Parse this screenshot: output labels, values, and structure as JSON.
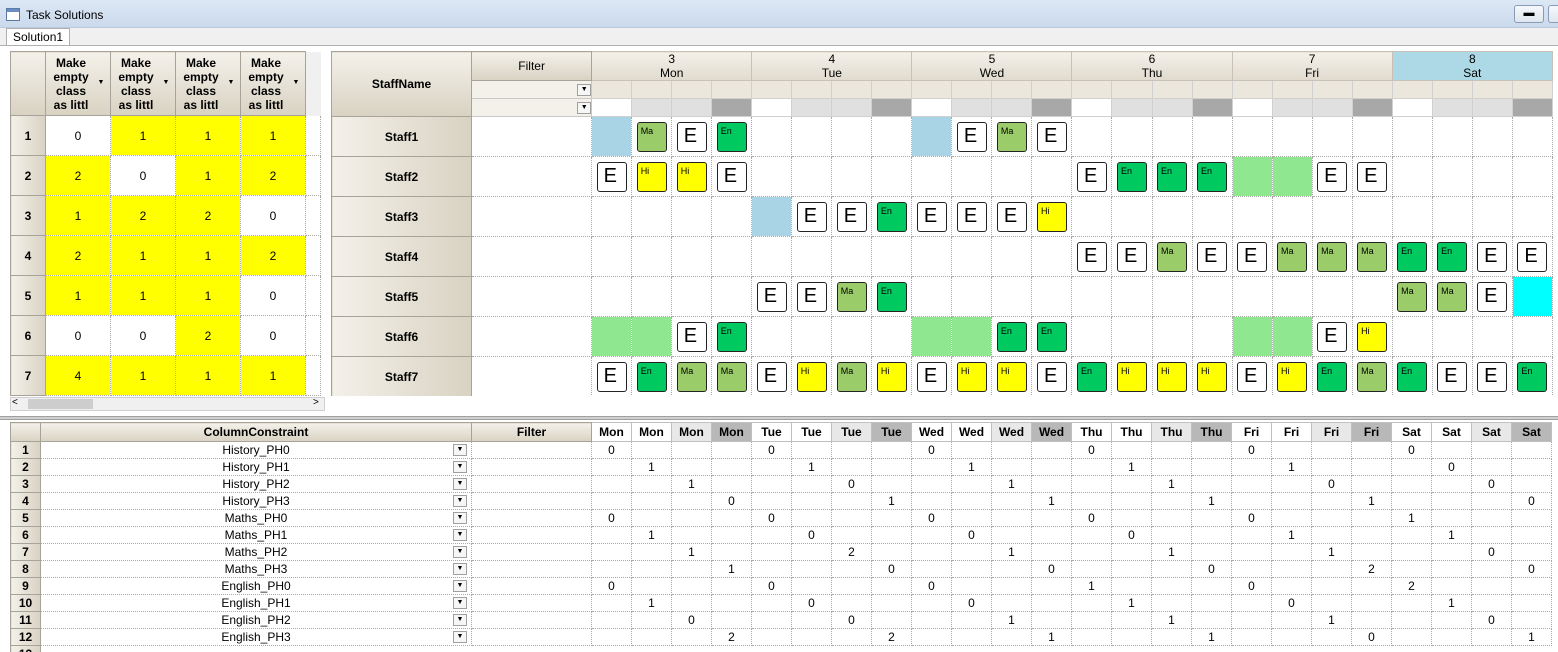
{
  "window": {
    "title": "Task Solutions",
    "minimize": "▬",
    "maximize": "▭"
  },
  "tab": {
    "label": "Solution1"
  },
  "left_grid": {
    "headers": [
      "Make empty class as littl",
      "Make empty class as littl",
      "Make empty class as littl",
      "Make empty class as littl"
    ],
    "rows": [
      {
        "n": "1",
        "v": [
          "0",
          "1",
          "1",
          "1"
        ],
        "hl": [
          false,
          true,
          true,
          true
        ]
      },
      {
        "n": "2",
        "v": [
          "2",
          "0",
          "1",
          "2"
        ],
        "hl": [
          true,
          false,
          true,
          true
        ]
      },
      {
        "n": "3",
        "v": [
          "1",
          "2",
          "2",
          "0"
        ],
        "hl": [
          true,
          true,
          true,
          false
        ]
      },
      {
        "n": "4",
        "v": [
          "2",
          "1",
          "1",
          "2"
        ],
        "hl": [
          true,
          true,
          true,
          true
        ]
      },
      {
        "n": "5",
        "v": [
          "1",
          "1",
          "1",
          "0"
        ],
        "hl": [
          true,
          true,
          true,
          false
        ]
      },
      {
        "n": "6",
        "v": [
          "0",
          "0",
          "2",
          "0"
        ],
        "hl": [
          false,
          false,
          true,
          false
        ]
      },
      {
        "n": "7",
        "v": [
          "4",
          "1",
          "1",
          "1"
        ],
        "hl": [
          true,
          true,
          true,
          true
        ]
      }
    ]
  },
  "schedule": {
    "staff_header": "StaffName",
    "filter_header": "Filter",
    "days": [
      {
        "num": "3",
        "name": "Mon",
        "hl": false
      },
      {
        "num": "4",
        "name": "Tue",
        "hl": false
      },
      {
        "num": "5",
        "name": "Wed",
        "hl": false
      },
      {
        "num": "6",
        "name": "Thu",
        "hl": false
      },
      {
        "num": "7",
        "name": "Fri",
        "hl": false
      },
      {
        "num": "8",
        "name": "Sat",
        "hl": true
      }
    ],
    "staff": [
      {
        "name": "Staff1",
        "cells": [
          "bg-blue",
          "Ma",
          "E",
          "En",
          "",
          "",
          "",
          "",
          "bg-blue",
          "E",
          "Ma",
          "E",
          "",
          "",
          "",
          "",
          "",
          "",
          "",
          "",
          "",
          "",
          "",
          ""
        ]
      },
      {
        "name": "Staff2",
        "cells": [
          "E",
          "Hi",
          "Hi",
          "E",
          "",
          "",
          "",
          "",
          "",
          "",
          "",
          "",
          "E",
          "En",
          "En",
          "En",
          "bg-green",
          "bg-green",
          "E",
          "E",
          "",
          "",
          "",
          ""
        ]
      },
      {
        "name": "Staff3",
        "cells": [
          "",
          "",
          "",
          "",
          "bg-blue",
          "E",
          "E",
          "En",
          "E",
          "E",
          "E",
          "Hi",
          "",
          "",
          "",
          "",
          "",
          "",
          "",
          "",
          "",
          "",
          "",
          ""
        ]
      },
      {
        "name": "Staff4",
        "cells": [
          "",
          "",
          "",
          "",
          "",
          "",
          "",
          "",
          "",
          "",
          "",
          "",
          "E",
          "E",
          "Ma",
          "E",
          "E",
          "Ma",
          "Ma",
          "Ma",
          "En",
          "En",
          "E",
          "E"
        ]
      },
      {
        "name": "Staff5",
        "cells": [
          "",
          "",
          "",
          "",
          "E",
          "E",
          "Ma",
          "En",
          "",
          "",
          "",
          "",
          "",
          "",
          "",
          "",
          "",
          "",
          "",
          "",
          "Ma",
          "Ma",
          "E",
          "bg-cyan"
        ]
      },
      {
        "name": "Staff6",
        "cells": [
          "bg-green",
          "bg-green",
          "E",
          "En",
          "",
          "",
          "",
          "",
          "bg-green",
          "bg-green",
          "En",
          "En",
          "",
          "",
          "",
          "",
          "bg-green",
          "bg-green",
          "E",
          "Hi",
          "",
          "",
          "",
          ""
        ]
      },
      {
        "name": "Staff7",
        "cells": [
          "E",
          "En",
          "Ma",
          "Ma",
          "E",
          "Hi",
          "Ma",
          "Hi",
          "E",
          "Hi",
          "Hi",
          "E",
          "En",
          "Hi",
          "Hi",
          "Hi",
          "E",
          "Hi",
          "En",
          "Ma",
          "En",
          "E",
          "E",
          "En"
        ]
      }
    ]
  },
  "constraints": {
    "col_header": "ColumnConstraint",
    "filter_header": "Filter",
    "day_cols": [
      "Mon",
      "Mon",
      "Mon",
      "Mon",
      "Tue",
      "Tue",
      "Tue",
      "Tue",
      "Wed",
      "Wed",
      "Wed",
      "Wed",
      "Thu",
      "Thu",
      "Thu",
      "Thu",
      "Fri",
      "Fri",
      "Fri",
      "Fri",
      "Sat",
      "Sat",
      "Sat",
      "Sat"
    ],
    "rows": [
      {
        "n": "1",
        "name": "History_PH0",
        "v": [
          "0",
          "",
          "",
          "",
          "0",
          "",
          "",
          "",
          "0",
          "",
          "",
          "",
          "0",
          "",
          "",
          "",
          "0",
          "",
          "",
          "",
          "0",
          "",
          "",
          ""
        ]
      },
      {
        "n": "2",
        "name": "History_PH1",
        "v": [
          "",
          "1",
          "",
          "",
          "",
          "1",
          "",
          "",
          "",
          "1",
          "",
          "",
          "",
          "1",
          "",
          "",
          "",
          "1",
          "",
          "",
          "",
          "0",
          "",
          ""
        ]
      },
      {
        "n": "3",
        "name": "History_PH2",
        "v": [
          "",
          "",
          "1",
          "",
          "",
          "",
          "0",
          "",
          "",
          "",
          "1",
          "",
          "",
          "",
          "1",
          "",
          "",
          "",
          "0",
          "",
          "",
          "",
          "0",
          ""
        ]
      },
      {
        "n": "4",
        "name": "History_PH3",
        "v": [
          "",
          "",
          "",
          "0",
          "",
          "",
          "",
          "1",
          "",
          "",
          "",
          "1",
          "",
          "",
          "",
          "1",
          "",
          "",
          "",
          "1",
          "",
          "",
          "",
          "0"
        ]
      },
      {
        "n": "5",
        "name": "Maths_PH0",
        "v": [
          "0",
          "",
          "",
          "",
          "0",
          "",
          "",
          "",
          "0",
          "",
          "",
          "",
          "0",
          "",
          "",
          "",
          "0",
          "",
          "",
          "",
          "1",
          "",
          "",
          ""
        ]
      },
      {
        "n": "6",
        "name": "Maths_PH1",
        "v": [
          "",
          "1",
          "",
          "",
          "",
          "0",
          "",
          "",
          "",
          "0",
          "",
          "",
          "",
          "0",
          "",
          "",
          "",
          "1",
          "",
          "",
          "",
          "1",
          "",
          ""
        ]
      },
      {
        "n": "7",
        "name": "Maths_PH2",
        "v": [
          "",
          "",
          "1",
          "",
          "",
          "",
          "2",
          "",
          "",
          "",
          "1",
          "",
          "",
          "",
          "1",
          "",
          "",
          "",
          "1",
          "",
          "",
          "",
          "0",
          ""
        ]
      },
      {
        "n": "8",
        "name": "Maths_PH3",
        "v": [
          "",
          "",
          "",
          "1",
          "",
          "",
          "",
          "0",
          "",
          "",
          "",
          "0",
          "",
          "",
          "",
          "0",
          "",
          "",
          "",
          "2",
          "",
          "",
          "",
          "0"
        ]
      },
      {
        "n": "9",
        "name": "English_PH0",
        "v": [
          "0",
          "",
          "",
          "",
          "0",
          "",
          "",
          "",
          "0",
          "",
          "",
          "",
          "1",
          "",
          "",
          "",
          "0",
          "",
          "",
          "",
          "2",
          "",
          "",
          ""
        ]
      },
      {
        "n": "10",
        "name": "English_PH1",
        "v": [
          "",
          "1",
          "",
          "",
          "",
          "0",
          "",
          "",
          "",
          "0",
          "",
          "",
          "",
          "1",
          "",
          "",
          "",
          "0",
          "",
          "",
          "",
          "1",
          "",
          ""
        ]
      },
      {
        "n": "11",
        "name": "English_PH2",
        "v": [
          "",
          "",
          "0",
          "",
          "",
          "",
          "0",
          "",
          "",
          "",
          "1",
          "",
          "",
          "",
          "1",
          "",
          "",
          "",
          "1",
          "",
          "",
          "",
          "0",
          ""
        ]
      },
      {
        "n": "12",
        "name": "English_PH3",
        "v": [
          "",
          "",
          "",
          "2",
          "",
          "",
          "",
          "2",
          "",
          "",
          "",
          "1",
          "",
          "",
          "",
          "1",
          "",
          "",
          "",
          "0",
          "",
          "",
          "",
          "1"
        ]
      }
    ],
    "partial_row": "13"
  },
  "colors": {
    "highlight": "#ffff00",
    "maths": "#9acd6a",
    "english": "#00c960",
    "history": "#ffff00",
    "sat_header": "#add8e6"
  }
}
